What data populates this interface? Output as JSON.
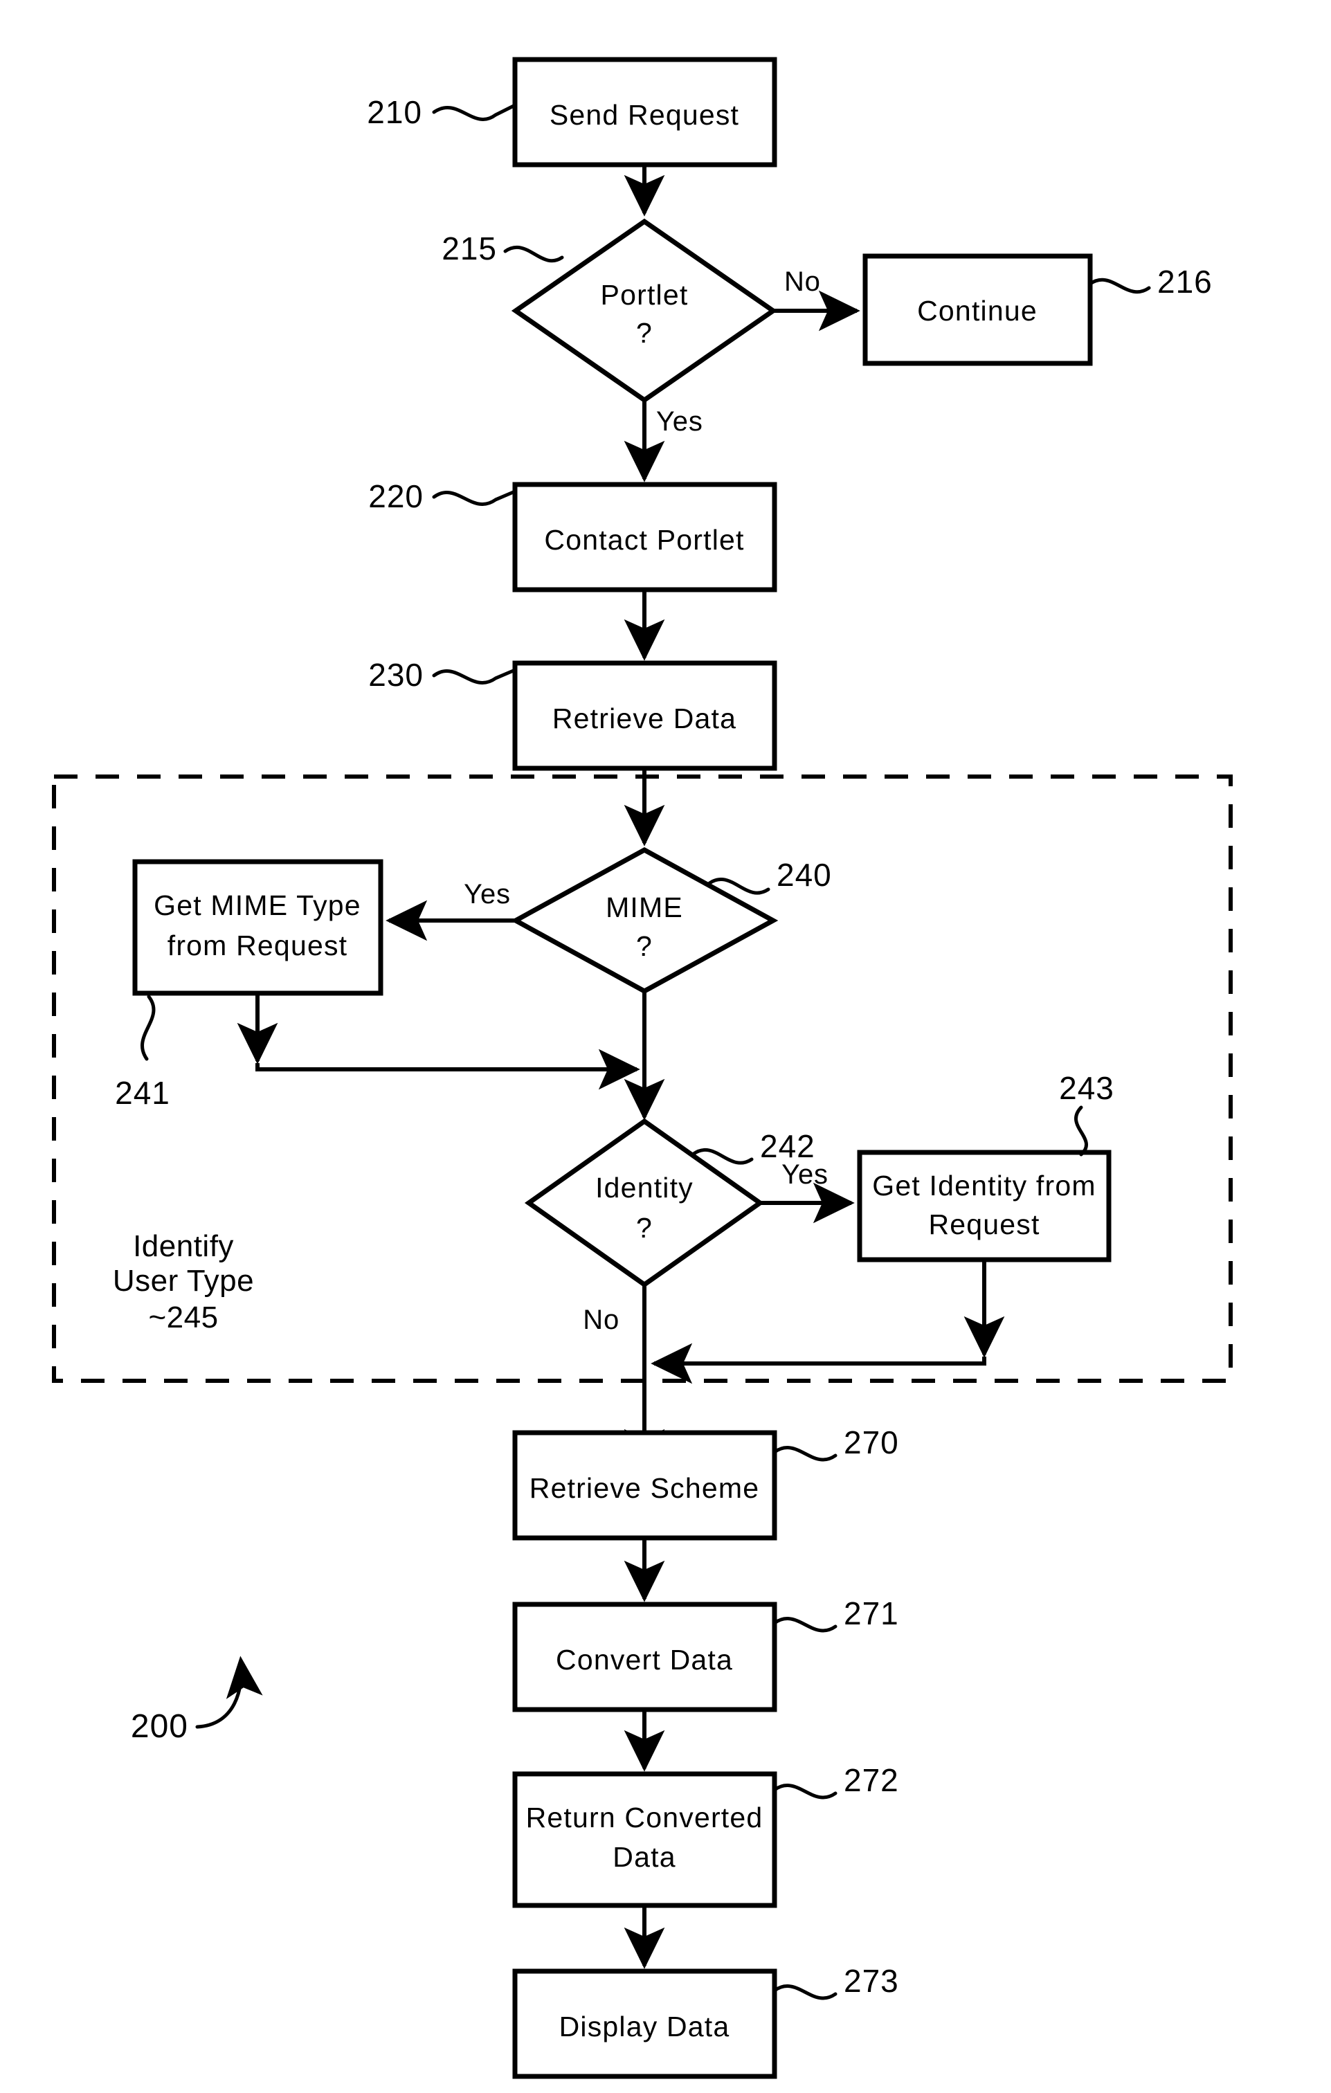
{
  "figure": {
    "number": "200",
    "type": "process-flowchart"
  },
  "nodes": {
    "send_request": {
      "ref": "210",
      "label": "Send Request",
      "shape": "rect"
    },
    "portlet_decision": {
      "ref": "215",
      "label_line1": "Portlet",
      "label_line2": "?",
      "shape": "diamond"
    },
    "continue": {
      "ref": "216",
      "label": "Continue",
      "shape": "rect"
    },
    "contact_portlet": {
      "ref": "220",
      "label": "Contact Portlet",
      "shape": "rect"
    },
    "retrieve_data": {
      "ref": "230",
      "label": "Retrieve Data",
      "shape": "rect"
    },
    "mime_decision": {
      "ref": "240",
      "label_line1": "MIME",
      "label_line2": "?",
      "shape": "diamond"
    },
    "get_mime_type": {
      "ref": "241",
      "label_line1": "Get MIME Type",
      "label_line2": "from Request",
      "shape": "rect"
    },
    "identity_decision": {
      "ref": "242",
      "label_line1": "Identity",
      "label_line2": "?",
      "shape": "diamond"
    },
    "get_identity": {
      "ref": "243",
      "label_line1": "Get Identity from",
      "label_line2": "Request",
      "shape": "rect"
    },
    "retrieve_scheme": {
      "ref": "270",
      "label": "Retrieve Scheme",
      "shape": "rect"
    },
    "convert_data": {
      "ref": "271",
      "label": "Convert Data",
      "shape": "rect"
    },
    "return_converted_data": {
      "ref": "272",
      "label_line1": "Return Converted",
      "label_line2": "Data",
      "shape": "rect"
    },
    "display_data": {
      "ref": "273",
      "label": "Display Data",
      "shape": "rect"
    }
  },
  "group": {
    "ref": "~245",
    "caption_line1": "Identify",
    "caption_line2": "User Type",
    "contains": [
      "240",
      "241",
      "242",
      "243"
    ]
  },
  "edge_labels": {
    "portlet_no": "No",
    "portlet_yes": "Yes",
    "mime_yes": "Yes",
    "identity_yes": "Yes",
    "identity_no": "No"
  },
  "colors": {
    "stroke": "#000000",
    "background": "#ffffff"
  }
}
